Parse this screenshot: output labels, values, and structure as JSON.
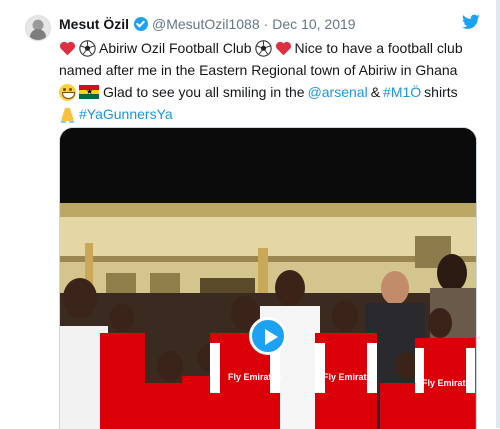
{
  "author": {
    "name": "Mesut Özil",
    "handle": "@MesutOzil1088",
    "separator": "·",
    "date": "Dec 10, 2019"
  },
  "tweet": {
    "line1_text": "Abiriw Ozil Football Club",
    "line1_tail": "Nice to have a football club",
    "line2_text": "named after me in the Eastern Regional town of Abiriw in Ghana",
    "line3_text": "Glad to see you all smiling in the",
    "mention": "@arsenal",
    "amp": "&",
    "hashtag1": "#M1Ö",
    "line3_tail": "shirts",
    "hashtag2": "#YaGunnersYa"
  },
  "media": {
    "type": "video",
    "shirt_sponsor": "Fly Emirates"
  },
  "colors": {
    "link": "#1b95e0",
    "verified": "#1da1f2",
    "play": "#1da1f2",
    "arsenal_red": "#db0007"
  },
  "icons": [
    "verified-badge-icon",
    "twitter-bird-icon",
    "heart-icon",
    "football-icon",
    "grinning-face-icon",
    "ghana-flag-icon",
    "praying-hands-icon",
    "play-icon"
  ]
}
